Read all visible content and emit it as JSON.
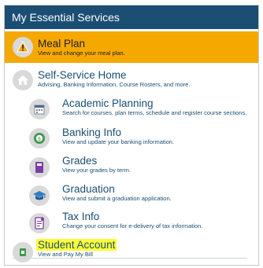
{
  "header": {
    "title": "My Essential Services"
  },
  "items": [
    {
      "title": "Meal Plan",
      "desc": "View and change your meal plan.",
      "icon": "warning-icon"
    },
    {
      "title": "Self-Service Home",
      "desc": "Advising, Banking Information, Course Rosters, and more.",
      "icon": "home-icon"
    },
    {
      "title": "Academic Planning",
      "desc": "Search for courses, plan terms, schedule and register course sections.",
      "icon": "calendar-icon"
    },
    {
      "title": "Banking Info",
      "desc": "View and update your banking information.",
      "icon": "money-icon"
    },
    {
      "title": "Grades",
      "desc": "View your grades by term.",
      "icon": "grades-book-icon"
    },
    {
      "title": "Graduation",
      "desc": "View and submit a graduation application.",
      "icon": "graduation-cap-icon"
    },
    {
      "title": "Tax Info",
      "desc": "Change your consent for e-delivery of tax information.",
      "icon": "tax-document-icon"
    },
    {
      "title": "Student Account",
      "desc": "View and Pay My Bill",
      "icon": "account-icon"
    }
  ],
  "colors": {
    "header_bg": "#1b4e73",
    "highlight_bg": "#f5a800",
    "text_highlight": "#ffff3a",
    "link_text": "#1b4e73"
  }
}
